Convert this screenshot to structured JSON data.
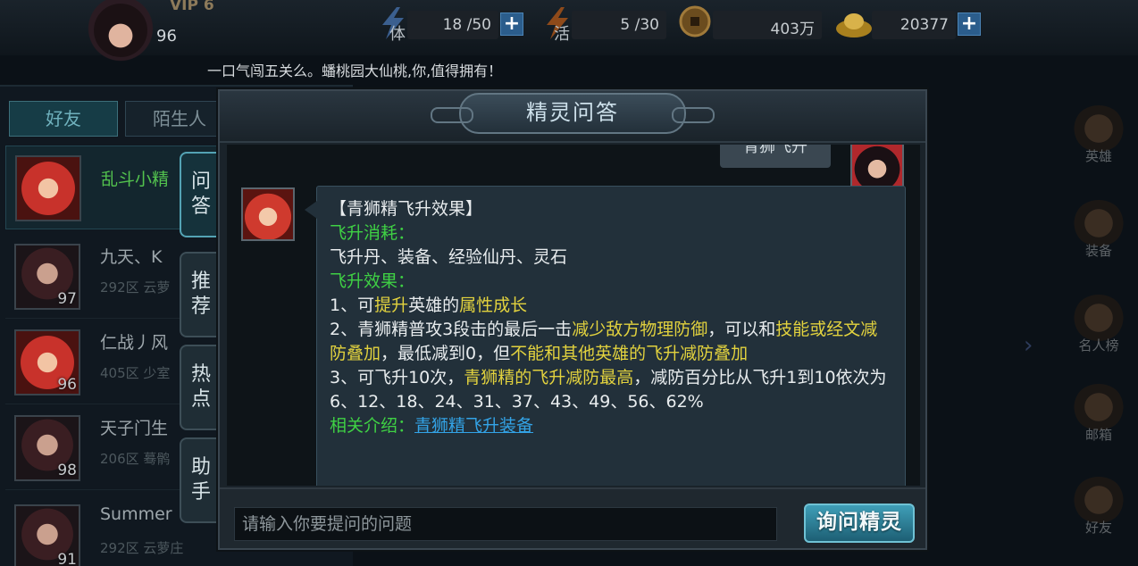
{
  "topbar": {
    "vip": "VIP 6",
    "level": "96",
    "stamina_glyph": "体",
    "stamina": "18 /50",
    "energy_glyph": "活",
    "energy": "5 /30",
    "coins": "403万",
    "gold": "20377",
    "marquee": "一口气闯五关么。蟠桃园大仙桃,你,值得拥有！"
  },
  "left": {
    "tabs": [
      {
        "label": "好友",
        "active": true
      },
      {
        "label": "陌生人",
        "active": false
      }
    ],
    "friends": [
      {
        "name": "乱斗小精",
        "level": "",
        "server": "",
        "selected": true
      },
      {
        "name": "九天、K",
        "level": "97",
        "server": "292区 云萝",
        "selected": false
      },
      {
        "name": "仁战丿风",
        "level": "96",
        "server": "405区 少室",
        "selected": false
      },
      {
        "name": "天子门生",
        "level": "98",
        "server": "206区 蓦鹘",
        "selected": false
      },
      {
        "name": "Summer",
        "level": "91",
        "server": "292区 云萝庄",
        "selected": false
      }
    ]
  },
  "side_tabs": [
    {
      "label": "问答",
      "active": true
    },
    {
      "label": "推荐",
      "active": false
    },
    {
      "label": "热点",
      "active": false
    },
    {
      "label": "助手",
      "active": false
    }
  ],
  "right_menu": [
    "英雄",
    "装备",
    "名人榜",
    "邮箱",
    "好友"
  ],
  "dialog": {
    "title": "精灵问答",
    "my_message": "青狮飞升",
    "answer": {
      "heading": "【青狮精飞升效果】",
      "cost_label": "飞升消耗：",
      "cost_text": "飞升丹、装备、经验仙丹、灵石",
      "effect_label": "飞升效果：",
      "item1_prefix": "1、可",
      "item1_hl1": "提升",
      "item1_mid": "英雄的",
      "item1_hl2": "属性成长",
      "item2_a": "2、青狮精普攻3段击的最后一击",
      "item2_hl1": "减少敌方物理防御",
      "item2_b": "，可以和",
      "item2_hl2": "技能或经文减防叠加",
      "item2_c": "，最低减到0，但",
      "item2_hl3": "不能和其他英雄的飞升减防叠加",
      "item3_a": "3、可飞升10次，",
      "item3_hl": "青狮精的飞升减防最高",
      "item3_b": "，减防百分比从飞升1到10依次为6、12、18、24、31、37、43、49、56、62%",
      "related_label": "相关介绍：",
      "related_link": "青狮精飞升装备"
    },
    "input_placeholder": "请输入你要提问的问题",
    "ask_button": "询问精灵"
  }
}
